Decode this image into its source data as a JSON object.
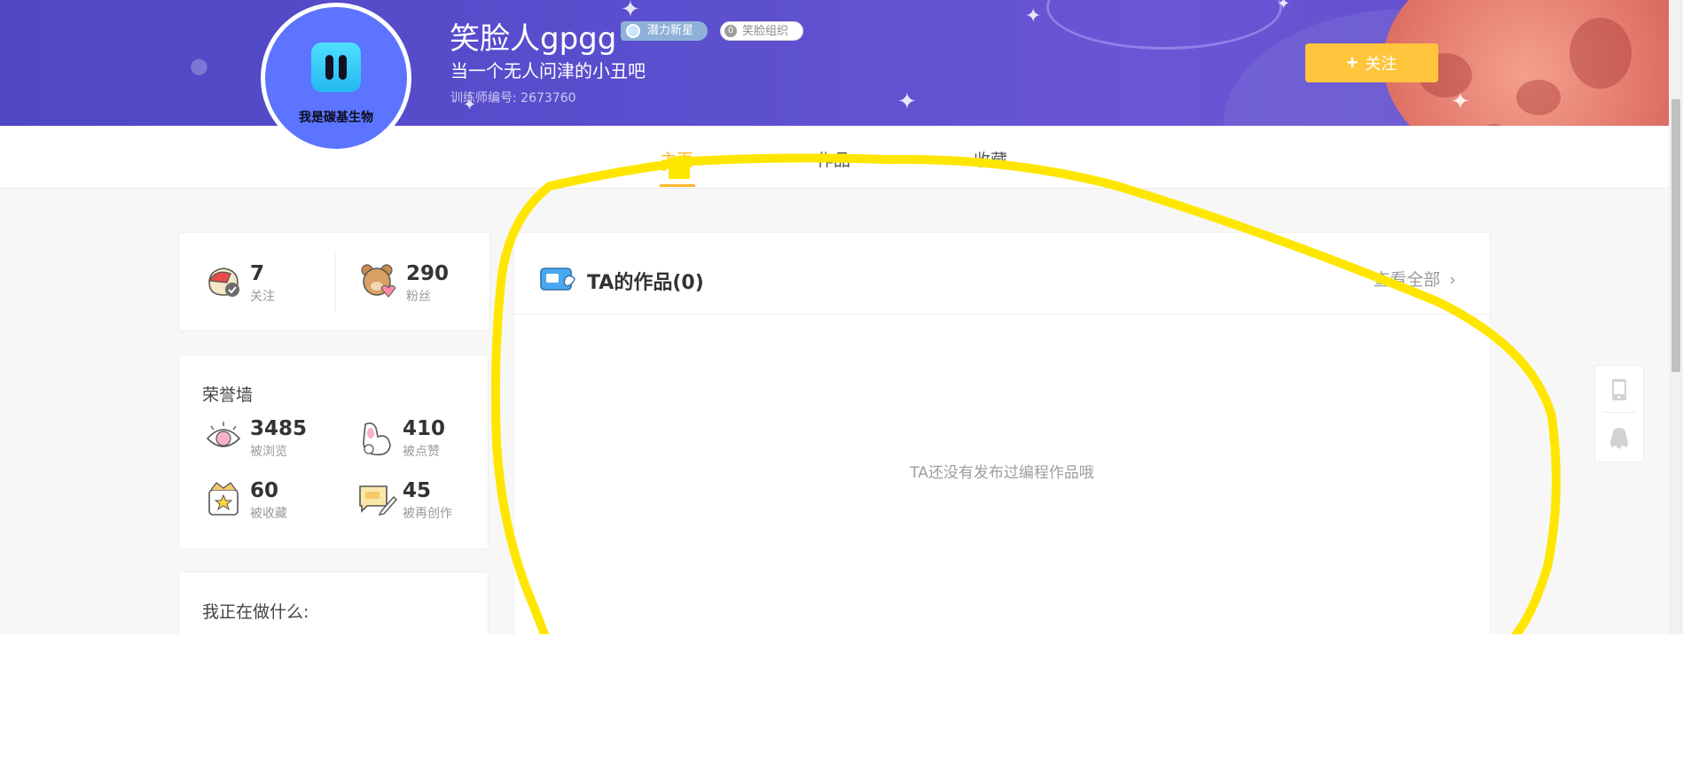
{
  "profile": {
    "avatar_text": "我是碳基生物",
    "name": "笑脸人gpgg",
    "badge_star": "潜力新星",
    "badge_org_num": "0",
    "badge_org": "笑脸组织",
    "bio": "当一个无人问津的小丑吧",
    "trainer_id": "训练师编号: 2673760",
    "follow_label": "关注"
  },
  "tabs": [
    {
      "label": "主页",
      "active": true
    },
    {
      "label": "作品",
      "active": false
    },
    {
      "label": "收藏",
      "active": false
    }
  ],
  "stats": {
    "following": {
      "value": "7",
      "label": "关注"
    },
    "fans": {
      "value": "290",
      "label": "粉丝"
    }
  },
  "honor": {
    "title": "荣誉墙",
    "items": [
      {
        "value": "3485",
        "label": "被浏览"
      },
      {
        "value": "410",
        "label": "被点赞"
      },
      {
        "value": "60",
        "label": "被收藏"
      },
      {
        "value": "45",
        "label": "被再创作"
      }
    ]
  },
  "doing": {
    "title": "我正在做什么:"
  },
  "works": {
    "title": "TA的作品(0)",
    "view_all": "查看全部",
    "empty": "TA还没有发布过编程作品哦"
  },
  "colors": {
    "accent": "#ffb62a",
    "banner": "#5a4fce",
    "annotation": "#ffe600"
  }
}
